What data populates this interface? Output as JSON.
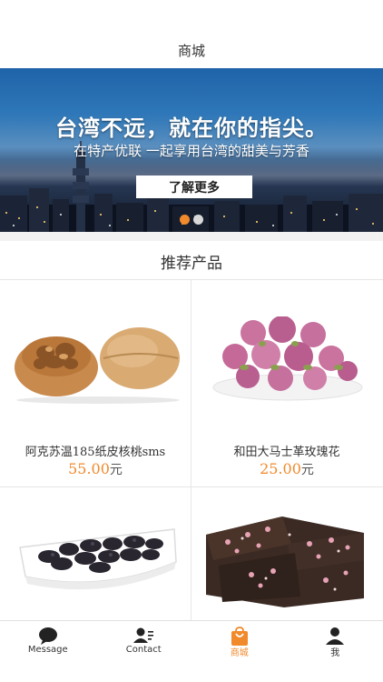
{
  "header": {
    "title": "商城"
  },
  "banner": {
    "headline": "台湾不远，就在你的指尖。",
    "subline": "在特产优联 一起享用台湾的甜美与芳香",
    "cta_label": "了解更多",
    "slide_count": 2,
    "active_slide": 1
  },
  "recommend": {
    "title": "推荐产品",
    "products": [
      {
        "name": "阿克苏温185纸皮核桃sms",
        "price": "55.00",
        "unit": "元",
        "image": "walnut-image"
      },
      {
        "name": "和田大马士革玫瑰花",
        "price": "25.00",
        "unit": "元",
        "image": "rose-tea-image"
      },
      {
        "name": "",
        "price": "",
        "unit": "",
        "image": "black-mulberry-image"
      },
      {
        "name": "",
        "price": "",
        "unit": "",
        "image": "rose-brown-sugar-image"
      }
    ]
  },
  "tabbar": {
    "tabs": [
      {
        "label": "Message",
        "icon": "message-icon",
        "active": false
      },
      {
        "label": "Contact",
        "icon": "contact-icon",
        "active": false
      },
      {
        "label": "商城",
        "icon": "shop-bag-icon",
        "active": true
      },
      {
        "label": "我",
        "icon": "person-icon",
        "active": false
      }
    ]
  },
  "colors": {
    "accent": "#f08a2c",
    "text": "#333333",
    "background": "#f2f2f2"
  }
}
